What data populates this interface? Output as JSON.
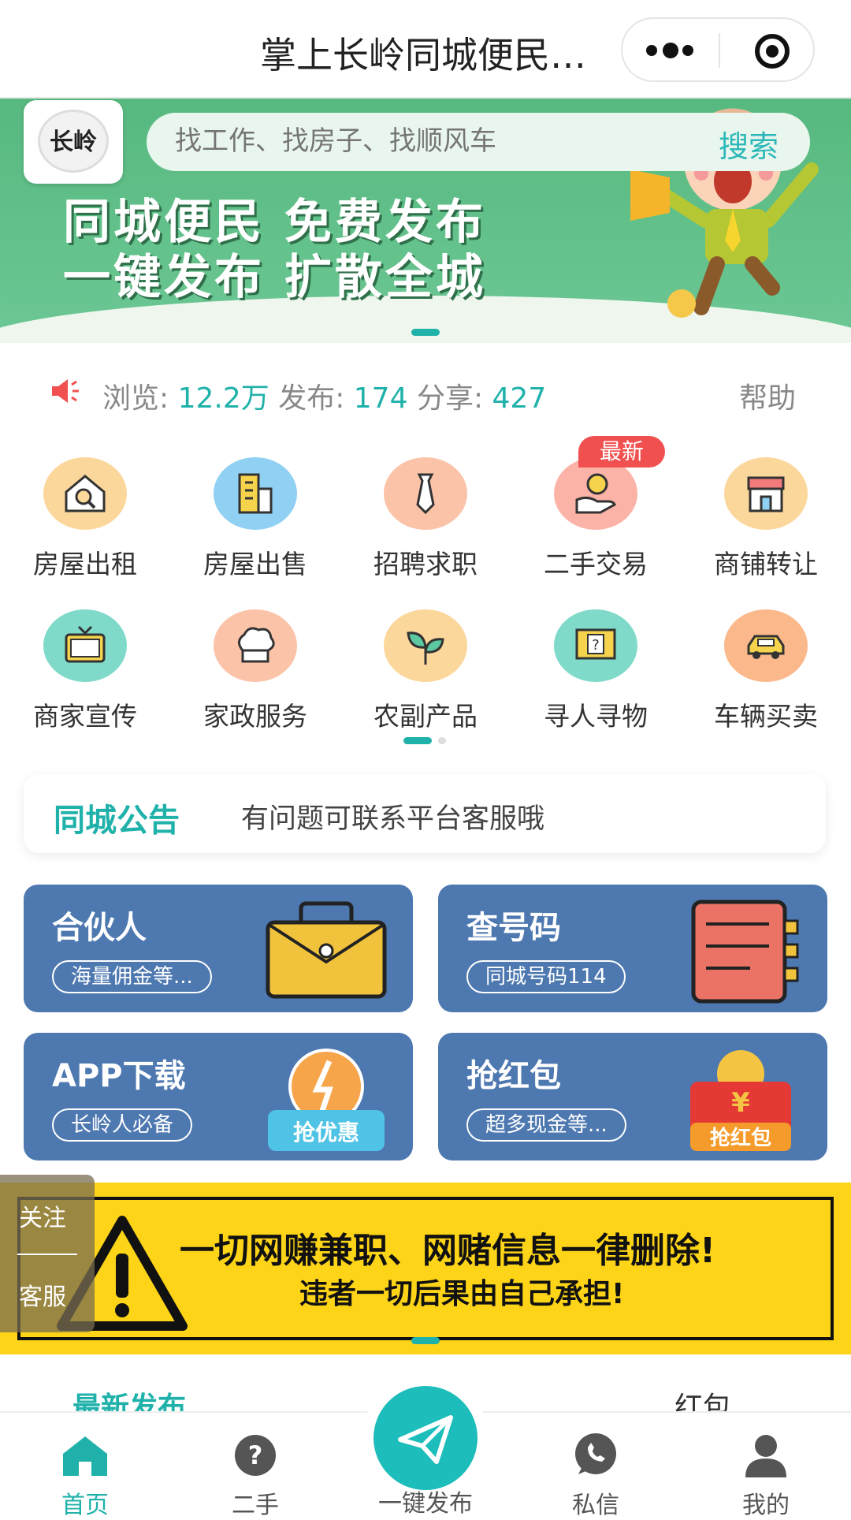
{
  "header": {
    "title": "掌上长岭同城便民信息平台"
  },
  "banner": {
    "logo_text": "长岭",
    "search_placeholder": "找工作、找房子、找顺风车",
    "search_button": "搜索",
    "slogan_line1": "同城便民 免费发布",
    "slogan_line2": "一键发布 扩散全城"
  },
  "stats": {
    "views_label": "浏览: ",
    "views": "12.2万",
    "posts_label": "发布: ",
    "posts": "174",
    "shares_label": "分享: ",
    "shares": "427",
    "help": "帮助"
  },
  "categories": [
    {
      "label": "房屋出租",
      "icon": "house-search-icon",
      "color": "#fbd79b"
    },
    {
      "label": "房屋出售",
      "icon": "building-icon",
      "color": "#8fd0f3"
    },
    {
      "label": "招聘求职",
      "icon": "tie-icon",
      "color": "#fbc3a8"
    },
    {
      "label": "二手交易",
      "icon": "coin-hand-icon",
      "color": "#fbb3a7"
    },
    {
      "label": "商铺转让",
      "icon": "shop-icon",
      "color": "#fbd79b"
    },
    {
      "label": "商家宣传",
      "icon": "tv-icon",
      "color": "#7fdac9"
    },
    {
      "label": "家政服务",
      "icon": "chef-hat-icon",
      "color": "#fbc3a8"
    },
    {
      "label": "农副产品",
      "icon": "leaf-icon",
      "color": "#fbd79b"
    },
    {
      "label": "寻人寻物",
      "icon": "question-card-icon",
      "color": "#7fdac9"
    },
    {
      "label": "车辆买卖",
      "icon": "car-icon",
      "color": "#fbb88a"
    }
  ],
  "new_badge": "最新",
  "notice": {
    "title": "同城公告",
    "message": "有问题可联系平台客服哦"
  },
  "cards": [
    {
      "title": "合伙人",
      "subtitle": "海量佣金等...",
      "art_label": ""
    },
    {
      "title": "查号码",
      "subtitle": "同城号码114",
      "art_label": ""
    },
    {
      "title": "APP下载",
      "subtitle": "长岭人必备",
      "art_label": "抢优惠"
    },
    {
      "title": "抢红包",
      "subtitle": "超多现金等...",
      "art_label": "抢红包"
    }
  ],
  "warning": {
    "line1": "一切网赚兼职、网赌信息一律删除!",
    "line2": "违者一切后果由自己承担!"
  },
  "float": {
    "follow": "关注",
    "service": "客服"
  },
  "latest": {
    "tab_left": "最新发布",
    "tab_right": "红包"
  },
  "tabbar": [
    {
      "label": "首页",
      "icon": "home-icon"
    },
    {
      "label": "二手",
      "icon": "question-icon"
    },
    {
      "label": "一键发布",
      "icon": "paper-plane-icon"
    },
    {
      "label": "私信",
      "icon": "chat-icon"
    },
    {
      "label": "我的",
      "icon": "user-icon"
    }
  ],
  "colors": {
    "accent": "#20b2aa",
    "card": "#4d78b0",
    "warning": "#fdd417",
    "banner": "#57b97f"
  }
}
